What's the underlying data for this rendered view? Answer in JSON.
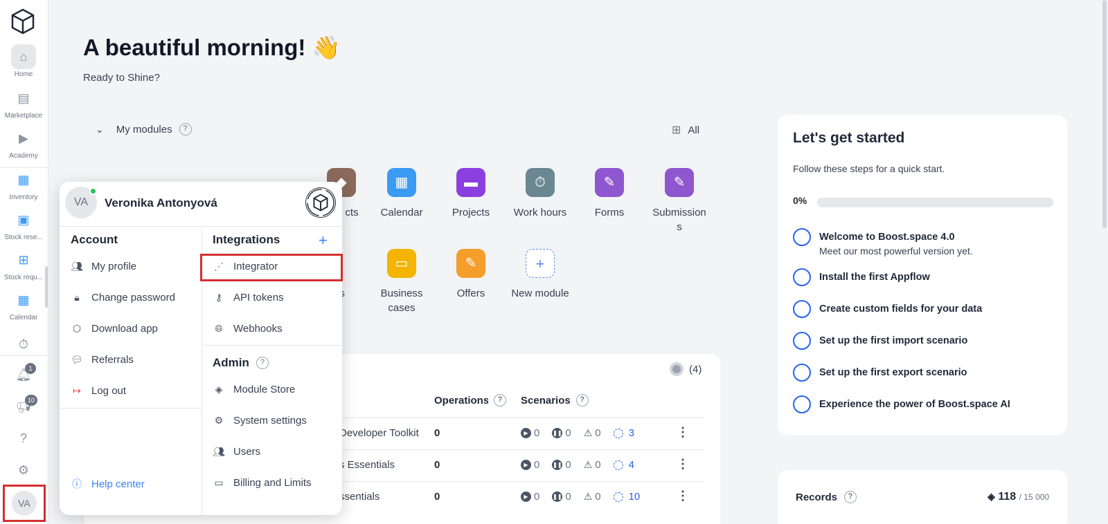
{
  "greeting": {
    "title": "A beautiful morning! 👋",
    "subtitle": "Ready to Shine?"
  },
  "sidebar": {
    "items": [
      {
        "label": "Home",
        "icon": "home-icon"
      },
      {
        "label": "Marketplace",
        "icon": "store-icon"
      },
      {
        "label": "Academy",
        "icon": "play-icon"
      },
      {
        "label": "Inventory",
        "icon": "inventory-icon"
      },
      {
        "label": "Stock rese...",
        "icon": "boxes-icon"
      },
      {
        "label": "Stock requ...",
        "icon": "cart-icon"
      },
      {
        "label": "Calendar",
        "icon": "calendar-icon"
      }
    ],
    "notifications_badge": "1",
    "announcements_badge": "10",
    "avatar": "VA"
  },
  "modules": {
    "header": "My modules",
    "all_label": "All",
    "row1": [
      {
        "label": "Calendar",
        "color": "#3b9af2",
        "icon": "calendar-icon"
      },
      {
        "label": "Projects",
        "color": "#8b3fe0",
        "icon": "folder-icon"
      },
      {
        "label": "Work hours",
        "color": "#6b8791",
        "icon": "stopwatch-icon"
      },
      {
        "label": "Forms",
        "color": "#8e56cf",
        "icon": "form-icon"
      },
      {
        "label": "Submission s",
        "color": "#8e56cf",
        "icon": "submission-icon"
      }
    ],
    "row1_partial": "cts",
    "row2": [
      {
        "label": "Business cases",
        "color": "#f4b400",
        "icon": "money-icon"
      },
      {
        "label": "Offers",
        "color": "#f59e2b",
        "icon": "offer-icon"
      },
      {
        "label": "New module",
        "icon": "plus-icon"
      }
    ],
    "row2_partial": "es"
  },
  "get_started": {
    "title": "Let's get started",
    "subtitle": "Follow these steps for a quick start.",
    "progress": "0%",
    "progress_value": 0,
    "steps": [
      {
        "title": "Welcome to Boost.space 4.0",
        "sub": "Meet our most powerful version yet."
      },
      {
        "title": "Install the first Appflow"
      },
      {
        "title": "Create custom fields for your data"
      },
      {
        "title": "Set up the first import scenario"
      },
      {
        "title": "Set up the first export scenario"
      },
      {
        "title": "Experience the power of Boost.space AI"
      }
    ]
  },
  "records": {
    "label": "Records",
    "value": "118",
    "limit": "/ 15 000"
  },
  "scenarios": {
    "count": "(4)",
    "col_operations": "Operations",
    "col_scenarios": "Scenarios",
    "rows": [
      {
        "name": "Developer Toolkit",
        "ops": "0",
        "running": "0",
        "paused": "0",
        "warnings": "0",
        "total": "3"
      },
      {
        "name": "s Essentials",
        "ops": "0",
        "running": "0",
        "paused": "0",
        "warnings": "0",
        "total": "4"
      },
      {
        "name": "ssentials",
        "ops": "0",
        "running": "0",
        "paused": "0",
        "warnings": "0",
        "total": "10"
      }
    ]
  },
  "popup": {
    "user_name": "Veronika Antonyová",
    "avatar": "VA",
    "account": {
      "title": "Account",
      "items": [
        "My profile",
        "Change password",
        "Download app",
        "Referrals",
        "Log out"
      ],
      "help": "Help center"
    },
    "integrations": {
      "title": "Integrations",
      "items": [
        "Integrator",
        "API tokens",
        "Webhooks"
      ]
    },
    "admin": {
      "title": "Admin",
      "items": [
        "Module Store",
        "System settings",
        "Users",
        "Billing and Limits"
      ]
    }
  }
}
